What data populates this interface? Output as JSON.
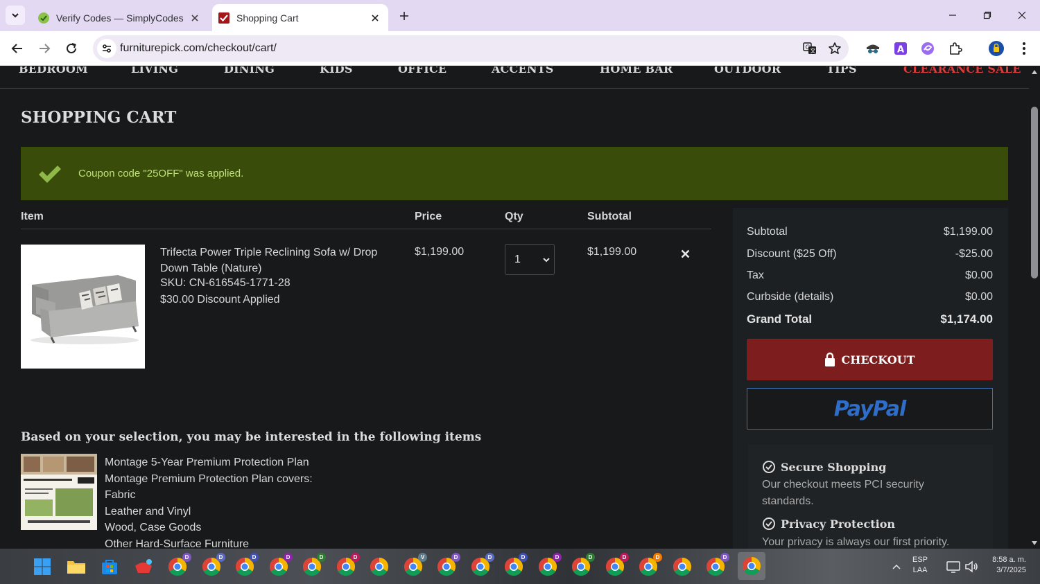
{
  "browser": {
    "tabs": [
      {
        "title": "Verify Codes — SimplyCodes",
        "active": false
      },
      {
        "title": "Shopping Cart",
        "active": true
      }
    ],
    "url": "furniturepick.com/checkout/cart/"
  },
  "nav": {
    "items": [
      "BEDROOM",
      "LIVING",
      "DINING",
      "KIDS",
      "OFFICE",
      "ACCENTS",
      "HOME BAR",
      "OUTDOOR",
      "TIPS"
    ],
    "clearance": "CLEARANCE SALE"
  },
  "page": {
    "title": "SHOPPING CART",
    "notice": "Coupon code \"25OFF\" was applied."
  },
  "cart": {
    "headers": {
      "item": "Item",
      "price": "Price",
      "qty": "Qty",
      "subtotal": "Subtotal"
    },
    "items": [
      {
        "name": "Trifecta Power Triple Reclining Sofa w/ Drop Down Table (Nature)",
        "sku": "SKU: CN-616545-1771-28",
        "discount": "$30.00 Discount Applied",
        "price": "$1,199.00",
        "qty": "1",
        "subtotal": "$1,199.00"
      }
    ]
  },
  "recommendations": {
    "title": "Based on your selection, you may be interested in the following items",
    "lines": [
      "Montage 5-Year Premium Protection Plan",
      "Montage Premium Protection Plan covers:",
      "Fabric",
      "Leather and Vinyl",
      "Wood, Case Goods",
      "Other Hard-Surface Furniture"
    ]
  },
  "summary": {
    "subtotal_label": "Subtotal",
    "subtotal": "$1,199.00",
    "discount_label": "Discount ($25 Off)",
    "discount": "-$25.00",
    "tax_label": "Tax",
    "tax": "$0.00",
    "curbside_label": "Curbside (details)",
    "curbside": "$0.00",
    "grand_label": "Grand Total",
    "grand": "$1,174.00",
    "checkout": "CHECKOUT",
    "paypal": "PayPal"
  },
  "security": {
    "secure_title": "Secure Shopping",
    "secure_text": "Our checkout meets PCI security standards.",
    "privacy_title": "Privacy Protection",
    "privacy_text": "Your privacy is always our first priority."
  },
  "taskbar": {
    "lang_line1": "ESP",
    "lang_line2": "LAA",
    "time": "8:58 a. m.",
    "date": "3/7/2025",
    "chrome_badges": [
      "D",
      "D",
      "D",
      "D",
      "D",
      "D",
      "",
      "V",
      "D",
      "D",
      "D",
      "D",
      "D",
      "D",
      "D",
      "",
      "D",
      ""
    ]
  },
  "colors": {
    "accent_checkout": "#7d1d1d",
    "notice_bg": "#3a4c0a",
    "notice_text": "#bfe27a",
    "clearance": "#d93c3c",
    "paypal_blue": "#2e6ec9"
  }
}
